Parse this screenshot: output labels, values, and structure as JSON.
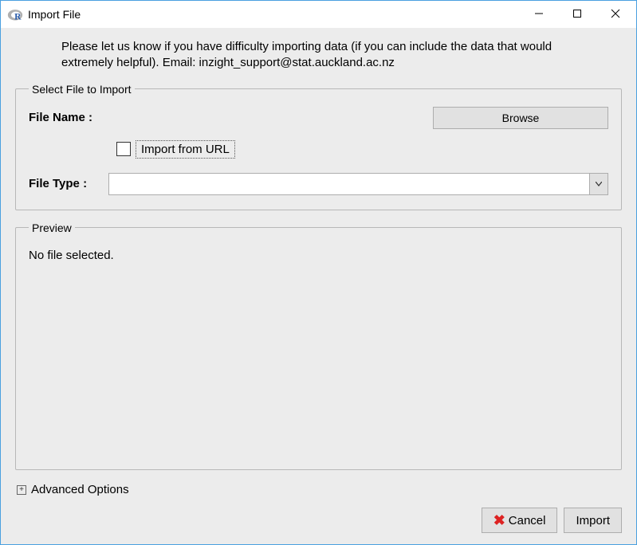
{
  "window": {
    "title": "Import File"
  },
  "help_text": "Please let us know if you have difficulty importing data (if you can include the data that would extremely helpful). Email: inzight_support@stat.auckland.ac.nz",
  "select_section": {
    "legend": "Select File to Import",
    "filename_label": "File Name :",
    "browse_label": "Browse",
    "import_url_label": "Import from URL",
    "filetype_label": "File Type :",
    "filetype_value": ""
  },
  "preview_section": {
    "legend": "Preview",
    "message": "No file selected."
  },
  "advanced_label": "Advanced Options",
  "footer": {
    "cancel": "Cancel",
    "import": "Import"
  }
}
